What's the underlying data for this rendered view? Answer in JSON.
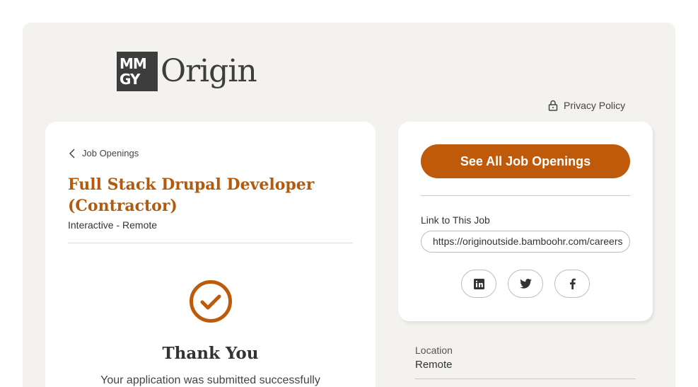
{
  "brand": {
    "mark_line1": "MM",
    "mark_line2": "GY",
    "wordmark": "Origin"
  },
  "privacy": {
    "label": "Privacy Policy"
  },
  "job": {
    "back_label": "Job Openings",
    "title": "Full Stack Drupal Developer (Contractor)",
    "subtitle": "Interactive - Remote"
  },
  "confirmation": {
    "heading": "Thank You",
    "message": "Your application was submitted successfully"
  },
  "sidebar": {
    "see_all_label": "See All Job Openings",
    "link_label": "Link to This Job",
    "link_value": "https://originoutside.bamboohr.com/careers",
    "share": [
      {
        "icon": "linkedin-icon"
      },
      {
        "icon": "twitter-icon"
      },
      {
        "icon": "facebook-icon"
      }
    ],
    "location_label": "Location",
    "location_value": "Remote"
  },
  "colors": {
    "accent": "#bf5a0b",
    "title": "#b35a0c",
    "background": "#f4f2ef"
  }
}
